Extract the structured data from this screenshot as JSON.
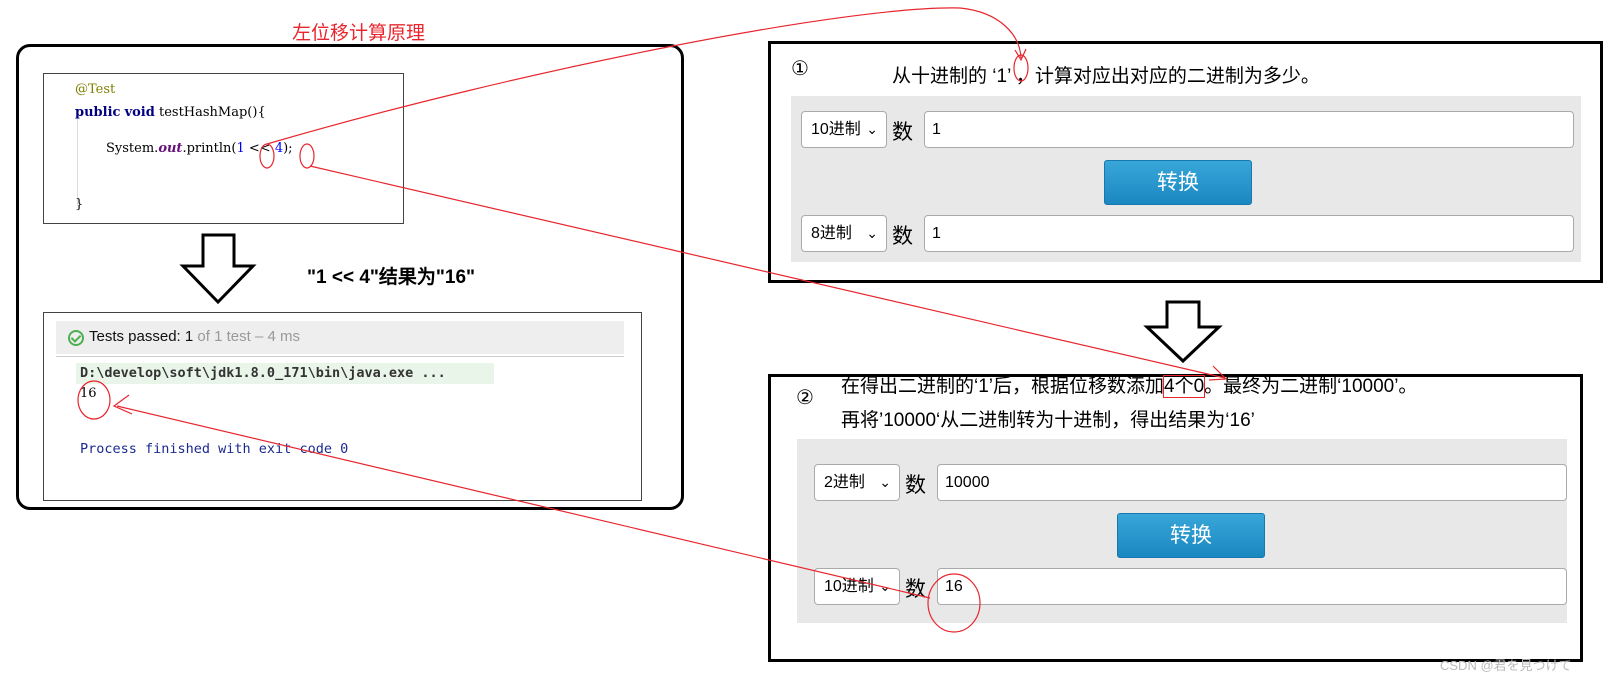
{
  "title": "左位移计算原理",
  "code": {
    "annotation": "@Test",
    "kw_public": "public",
    "kw_void": "void",
    "method": "testHashMap(){",
    "stmt_pre": "System.",
    "stmt_field": "out",
    "stmt_mid": ".println(",
    "num_a": "1",
    "op": " << ",
    "num_b": "4",
    "stmt_end": ");",
    "close_brace": "}"
  },
  "result_text": "\"1 << 4\"结果为\"16\"",
  "console": {
    "passed_label": "Tests passed:",
    "passed_count": "1",
    "passed_detail": "of 1 test – 4 ms",
    "cmd": "D:\\develop\\soft\\jdk1.8.0_171\\bin\\java.exe ...",
    "output": "16",
    "exit": "Process finished with exit code 0"
  },
  "step1": {
    "marker": "①",
    "desc_pre": "从十进制的",
    "desc_q": "‘1’",
    "desc_post": "，计算对应出对应的二进制为多少。",
    "from_base": "10进制",
    "shu": "数",
    "from_value": "1",
    "button": "转换",
    "to_base": "8进制",
    "to_value": "1"
  },
  "step2": {
    "marker": "②",
    "line1_pre": "在得出二进制的‘1’后，根据位移数添加",
    "line1_box": "4个0",
    "line1_post": "。最终为二进制‘10000’。",
    "line2": "再将’10000‘从二进制转为十进制，得出结果为‘16’",
    "from_base": "2进制",
    "shu": "数",
    "from_value": "10000",
    "button": "转换",
    "to_base": "10进制",
    "to_value": "16"
  },
  "watermark": "CSDN @君を見つけて",
  "colors": {
    "annotation_red": "#e8262e",
    "button_blue": "#2a98cf"
  }
}
